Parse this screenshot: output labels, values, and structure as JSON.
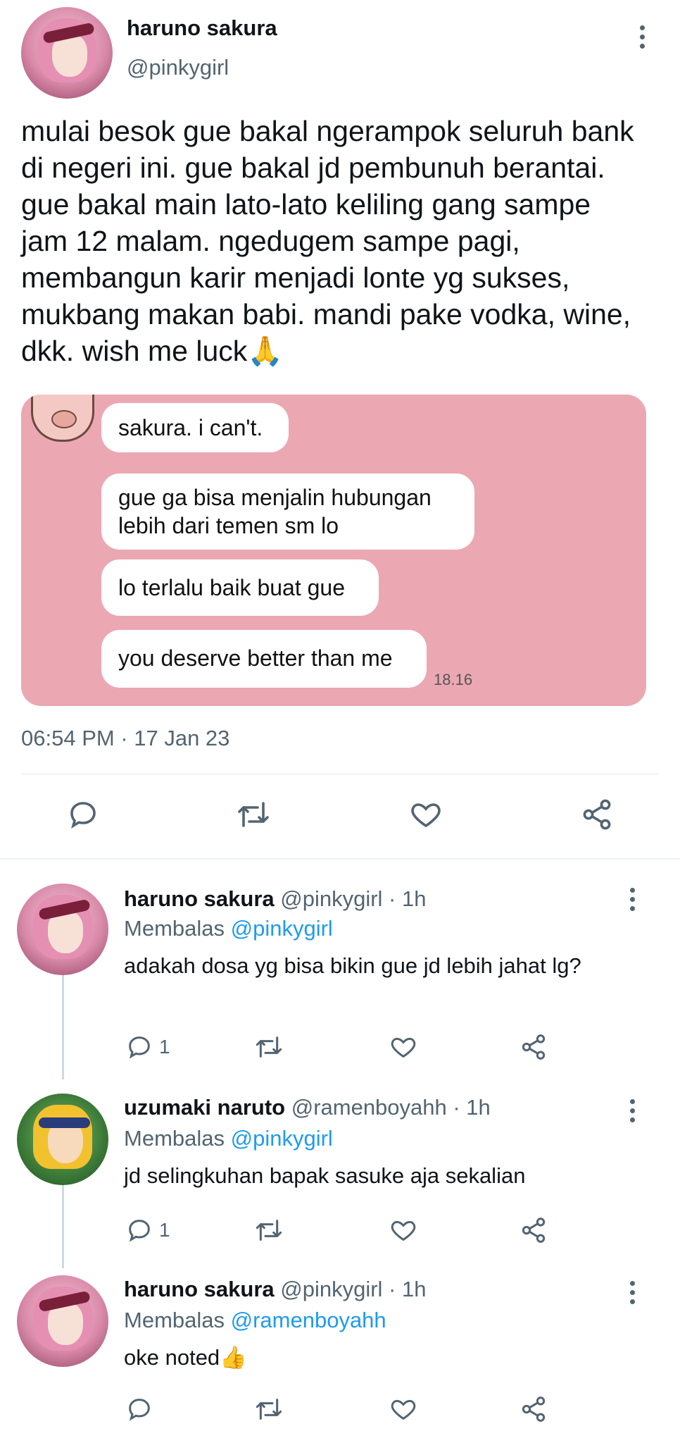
{
  "main_tweet": {
    "author_name": "haruno sakura",
    "author_handle": "@pinkygirl",
    "text": "mulai besok gue bakal ngerampok seluruh bank di negeri ini. gue bakal jd pembunuh berantai. gue bakal main lato-lato keliling gang sampe jam 12 malam. ngedugem sampe pagi, membangun karir menjadi lonte yg sukses, mukbang makan babi. mandi pake vodka, wine, dkk. wish me luck🙏",
    "chat_image": {
      "messages": [
        "sakura. i can't.",
        "gue ga bisa menjalin hubungan\nlebih dari temen sm lo",
        "lo terlalu baik buat gue",
        "you deserve better than me"
      ],
      "time": "18.16",
      "background_color": "#eba8b2"
    },
    "timestamp": "06:54 PM · 17 Jan 23",
    "actions": [
      "reply-icon",
      "retweet-icon",
      "like-icon",
      "share-icon"
    ]
  },
  "replies": [
    {
      "name": "haruno sakura",
      "handle_time": "@pinkygirl · 1h",
      "replying_prefix": "Membalas",
      "replying_to": "@pinkygirl",
      "text": "adakah dosa yg bisa bikin gue jd lebih jahat lg?",
      "reply_count": "1"
    },
    {
      "name": "uzumaki naruto",
      "handle_time": "@ramenboyahh · 1h",
      "replying_prefix": "Membalas",
      "replying_to": "@pinkygirl",
      "text": "jd selingkuhan bapak sasuke aja sekalian",
      "reply_count": "1"
    },
    {
      "name": "haruno sakura",
      "handle_time": "@pinkygirl · 1h",
      "replying_prefix": "Membalas",
      "replying_to": "@ramenboyahh",
      "text": "oke noted👍",
      "reply_count": ""
    }
  ],
  "colors": {
    "text": "#0f1419",
    "secondary": "#536471",
    "link": "#1d9bf0"
  }
}
